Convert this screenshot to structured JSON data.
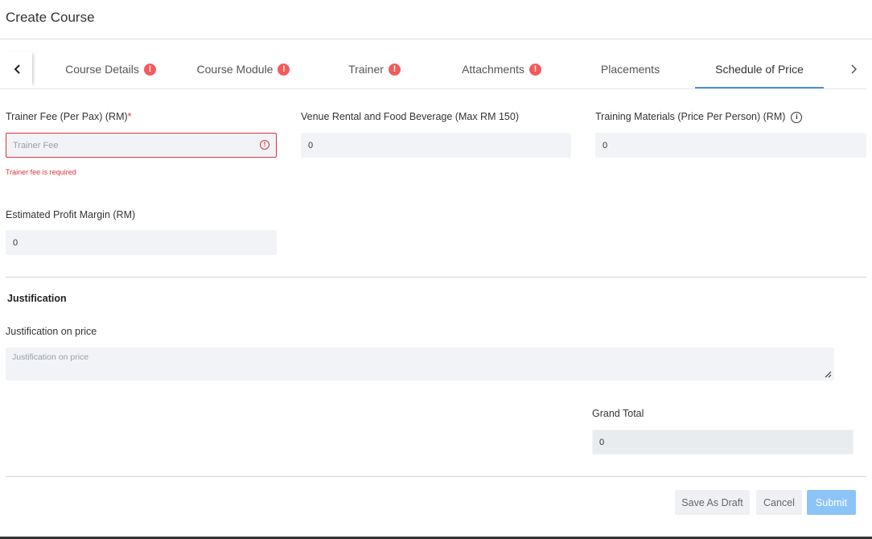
{
  "header": {
    "title": "Create Course"
  },
  "tabs": [
    {
      "label": "Course Details",
      "warning": true
    },
    {
      "label": "Course Module",
      "warning": true
    },
    {
      "label": "Trainer",
      "warning": true
    },
    {
      "label": "Attachments",
      "warning": true
    },
    {
      "label": "Placements",
      "warning": false
    },
    {
      "label": "Schedule of Price",
      "warning": false,
      "active": true
    }
  ],
  "form": {
    "trainer_fee": {
      "label": "Trainer Fee (Per Pax) (RM)",
      "required_mark": "*",
      "placeholder": "Trainer Fee",
      "value": "",
      "error": "Trainer fee is required"
    },
    "venue_rental": {
      "label": "Venue Rental and Food Beverage (Max RM 150)",
      "value": "0"
    },
    "training_materials": {
      "label": "Training Materials (Price Per Person) (RM)",
      "value": "0"
    },
    "profit_margin": {
      "label": "Estimated Profit Margin (RM)",
      "value": "0"
    }
  },
  "justification": {
    "heading": "Justification",
    "label": "Justification on price",
    "placeholder": "Justification on price"
  },
  "grand_total": {
    "label": "Grand Total",
    "value": "0"
  },
  "buttons": {
    "save_draft": "Save As Draft",
    "cancel": "Cancel",
    "submit": "Submit"
  },
  "colors": {
    "accent": "#4a90d9",
    "error": "#d9363e",
    "warning_badge": "#f35b5b",
    "submit_bg": "#8cc4f8"
  },
  "icons": {
    "tab_warning": "exclamation-circle-icon",
    "info": "info-circle-icon",
    "nav_left": "chevron-left-icon",
    "nav_right": "chevron-right-icon"
  }
}
